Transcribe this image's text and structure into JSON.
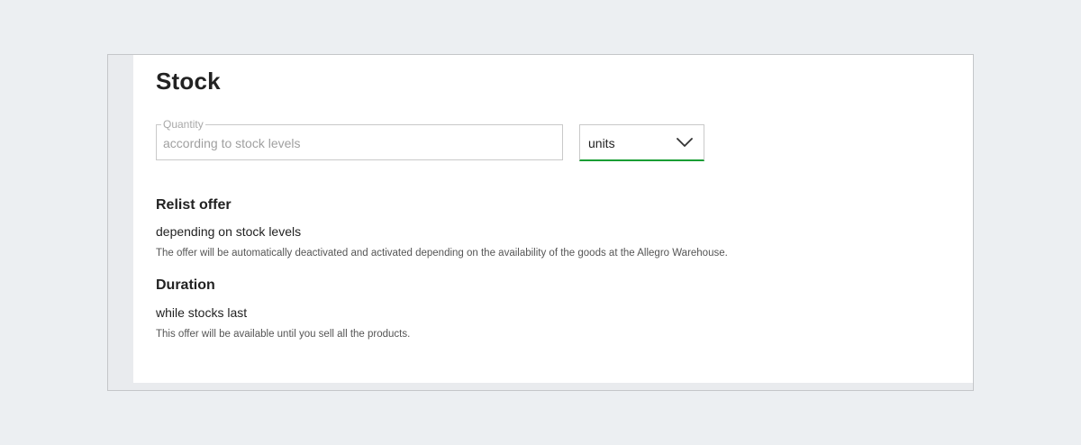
{
  "stock": {
    "title": "Stock",
    "quantity": {
      "label": "Quantity",
      "value": "according to stock levels"
    },
    "unit_select": {
      "selected": "units"
    }
  },
  "relist": {
    "heading": "Relist offer",
    "value": "depending on stock levels",
    "description": "The offer will be automatically deactivated and activated depending on the availability of the goods at the Allegro Warehouse."
  },
  "duration": {
    "heading": "Duration",
    "value": "while stocks last",
    "description": "This offer will be available until you sell all the products."
  },
  "theme": {
    "accent": "#1a9e35"
  },
  "icons": {
    "unit_select": "chevron-down-icon"
  }
}
